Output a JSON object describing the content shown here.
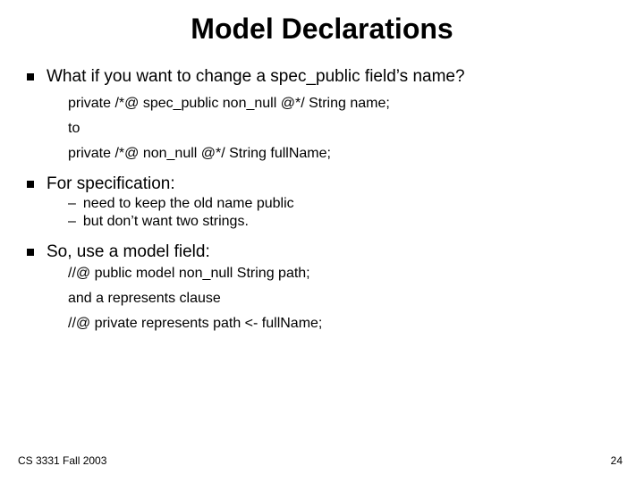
{
  "title": "Model Declarations",
  "bullet1": "What if you want to change a spec_public field’s name?",
  "code1": "private /*@ spec_public non_null @*/ String name;",
  "to": "to",
  "code2": "private /*@ non_null @*/ String fullName;",
  "bullet2": "For specification:",
  "dash1": "need to keep the old name public",
  "dash2": "but don’t want two strings.",
  "bullet3": "So, use a model field:",
  "code3": "//@ public model non_null String path;",
  "and": "and a represents clause",
  "code4": "//@ private represents path <- fullName;",
  "footer_left": "CS 3331 Fall 2003",
  "footer_right": "24"
}
